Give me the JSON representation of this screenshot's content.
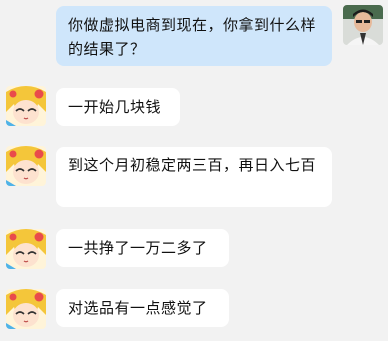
{
  "colors": {
    "background": "#f2f2f2",
    "incoming_bubble": "#ffffff",
    "outgoing_bubble": "#cfe6fb",
    "text": "#111111"
  },
  "chat": {
    "messages": [
      {
        "sender": "me",
        "avatar": "user-photo-avatar",
        "text": "你做虚拟电商到现在，你拿到什么样的结果了？"
      },
      {
        "sender": "other",
        "avatar": "anime-girl-avatar",
        "text": "一开始几块钱"
      },
      {
        "sender": "other",
        "avatar": "anime-girl-avatar",
        "text": "到这个月初稳定两三百，再日入七百"
      },
      {
        "sender": "other",
        "avatar": "anime-girl-avatar",
        "text": "一共挣了一万二多了"
      },
      {
        "sender": "other",
        "avatar": "anime-girl-avatar",
        "text": "对选品有一点感觉了"
      }
    ]
  }
}
